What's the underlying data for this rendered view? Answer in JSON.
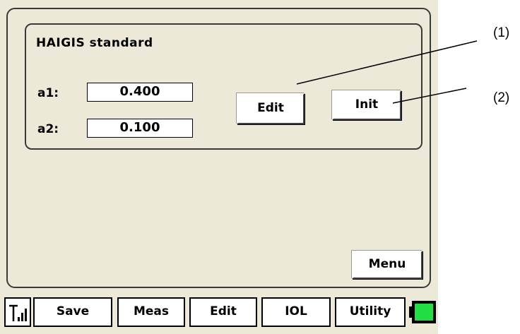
{
  "panel": {
    "title": "HAIGIS standard",
    "params": [
      {
        "label": "a1:",
        "value": "0.400"
      },
      {
        "label": "a2:",
        "value": "0.100"
      }
    ],
    "edit_label": "Edit",
    "init_label": "Init"
  },
  "menu_label": "Menu",
  "bottom_bar": {
    "signal_icon": "signal-icon",
    "tabs": [
      "Save",
      "Meas",
      "Edit",
      "IOL",
      "Utility"
    ],
    "battery_color": "#22dd44"
  },
  "callouts": [
    "(1)",
    "(2)"
  ],
  "colors": {
    "background": "#ece9d8",
    "border": "#3a3a3a"
  }
}
